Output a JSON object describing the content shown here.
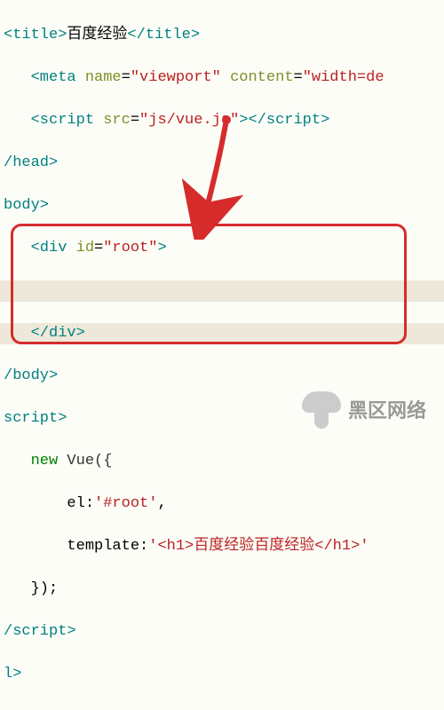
{
  "code": {
    "l1_tag1": "<title>",
    "l1_txt": "百度经验",
    "l1_tag2": "</title>",
    "l2_tag": "<meta",
    "l2_attr1": "name",
    "l2_val1": "\"viewport\"",
    "l2_attr2": "content",
    "l2_val2": "\"width=de",
    "l3_tag": "<script",
    "l3_attr": "src",
    "l3_val": "\"js/vue.js\"",
    "l3_close": "></",
    "l3_close2": "script>",
    "l4": "/head>",
    "l5": "body>",
    "l6_tag": "<div",
    "l6_attr": "id",
    "l6_val": "\"root\"",
    "l6_close": ">",
    "l7": "</div>",
    "l8": "/body>",
    "l9": "script>",
    "l10_kw": "new",
    "l10_cls": "Vue({",
    "l11_key": "el:",
    "l11_val": "'#root'",
    "l12_key": "template:",
    "l12_val": "'<h1>百度经验百度经验</h1>'",
    "l13": "});",
    "l14": "/script>",
    "l15": "l>"
  },
  "watermark": "黑区网络"
}
